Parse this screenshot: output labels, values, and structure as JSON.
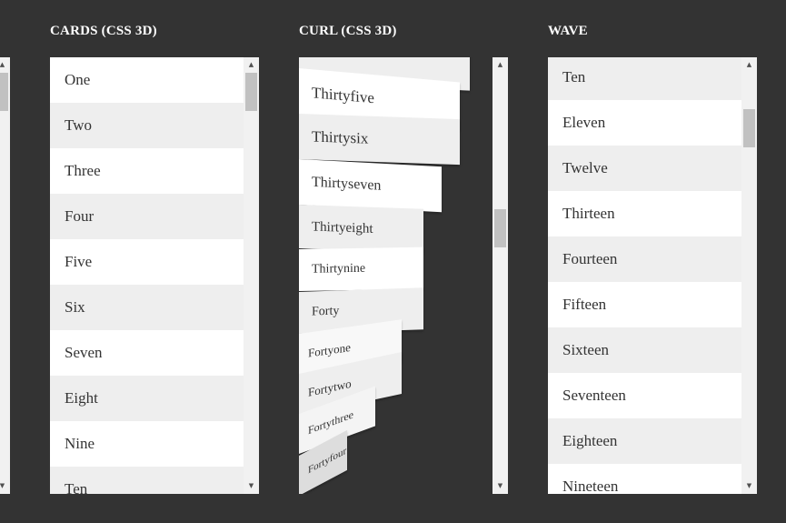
{
  "headings": {
    "cards": "CARDS (CSS 3D)",
    "curl": "CURL (CSS 3D)",
    "wave": "WAVE"
  },
  "cards": {
    "items": [
      "One",
      "Two",
      "Three",
      "Four",
      "Five",
      "Six",
      "Seven",
      "Eight",
      "Nine",
      "Ten"
    ]
  },
  "curl": {
    "items": [
      "Thirtyfive",
      "Thirtysix",
      "Thirtyseven",
      "Thirtyeight",
      "Thirtynine",
      "Forty",
      "Fortyone",
      "Fortytwo",
      "Fortythree",
      "Fortyfour"
    ]
  },
  "wave": {
    "items": [
      "Ten",
      "Eleven",
      "Twelve",
      "Thirteen",
      "Fourteen",
      "Fifteen",
      "Sixteen",
      "Seventeen",
      "Eighteen",
      "Nineteen"
    ]
  },
  "icons": {
    "scroll_up": "triangle-up",
    "scroll_down": "triangle-down"
  },
  "colors": {
    "background": "#333333",
    "row_light": "#ffffff",
    "row_dark": "#eeeeee",
    "text": "#333333",
    "heading": "#ffffff"
  }
}
